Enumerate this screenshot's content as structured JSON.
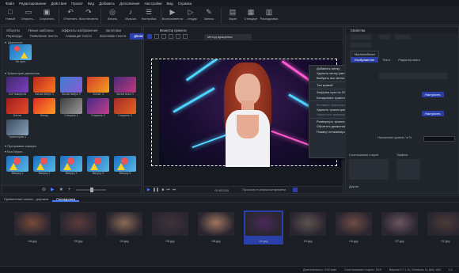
{
  "menu": [
    "Файл",
    "Редактирование",
    "Действия",
    "Проект",
    "Вид",
    "Добавить",
    "Дополнения",
    "Настройки",
    "Вид",
    "Справка"
  ],
  "toolbar": [
    {
      "label": "Новый",
      "icon": "□"
    },
    {
      "label": "Открыть…",
      "icon": "▭"
    },
    {
      "label": "Сохранить",
      "icon": "▣"
    },
    {
      "label": "Отменить",
      "icon": "↶"
    },
    {
      "label": "Восстановить",
      "icon": "↷"
    },
    {
      "label": "Изъять",
      "icon": "◎"
    },
    {
      "label": "Музыка",
      "icon": "♪"
    },
    {
      "label": "Настройка",
      "icon": "☰"
    },
    {
      "label": "Воспроизвести",
      "icon": "▶"
    },
    {
      "label": "…откуда",
      "icon": "▷"
    },
    {
      "label": "Запись",
      "icon": "✎"
    },
    {
      "label": "Экран",
      "icon": "▤"
    },
    {
      "label": "Стандарт",
      "icon": "▦"
    },
    {
      "label": "Раскадровка",
      "icon": "▥"
    }
  ],
  "left_panel": {
    "tabs_row1": [
      "Объекты",
      "Умные шаблоны",
      "Эффекты изображения",
      "Заголовки"
    ],
    "tabs_row2": [
      "Переходы",
      "Появление текста",
      "Анимация текста",
      "Заголовки текста",
      "Движение",
      "Фоны"
    ],
    "active_tab": "Движение",
    "section1": "Движение",
    "first_item": "Не путь",
    "section2": "Траектории движения",
    "items": [
      "2х2 поворота",
      "Зигзаг вверх 1",
      "Зигзаг вверх 2",
      "Зигзаг 3",
      "Зигзаг вниз 1",
      "Бегом",
      "Внизу",
      "Спираль 1",
      "Спираль 2",
      "Спираль 3",
      "Траектория 1"
    ],
    "section3": "Программы камеры",
    "section4": "Вся Верхн.",
    "camera_items": [
      "Вверху 1",
      "Вверху 2",
      "Вверху 3",
      "Вверху 4",
      "Вверху 5"
    ]
  },
  "center": {
    "title": "Монитор проекта",
    "dropdown": "Метод вращения",
    "timecode": "00:00.000",
    "preview_label": "Просмотр в реальном времени"
  },
  "context_menu": {
    "items": [
      {
        "label": "Добавить метку",
        "key": "Ins",
        "disabled": false
      },
      {
        "label": "Удалить метку (метки)",
        "key": "Del",
        "disabled": false
      },
      {
        "label": "Выбрать все метки",
        "key": "Ctrl+A",
        "disabled": false
      },
      {
        "label": "Тип кривой",
        "key": "›",
        "disabled": false
      },
      {
        "label": "Загрузка пути из SPX файла…",
        "key": "",
        "disabled": false
      },
      {
        "label": "Копировать траекторию",
        "key": "",
        "disabled": false
      },
      {
        "label": "Вставить траекторию",
        "key": "",
        "disabled": true
      },
      {
        "label": "Удалить траекторию",
        "key": "",
        "disabled": false
      },
      {
        "label": "Упростить траекторию",
        "key": "",
        "disabled": true
      },
      {
        "label": "Развернуть траекторию",
        "key": "",
        "disabled": false
      },
      {
        "label": "Обратить движение по пути",
        "key": "",
        "disabled": false
      },
      {
        "label": "Размер оптимизированное",
        "key": "",
        "disabled": false
      }
    ]
  },
  "right_panel": {
    "title": "Свойства",
    "tag": "Мультиобъект",
    "tabs": [
      "Изображение",
      "Текст",
      "Редактировать"
    ],
    "btn1": "Настроить",
    "btn2": "Настроить",
    "field": "Отключить (без настроек)",
    "label1": "Наложение уровня / в %",
    "label2": "Соотношение сторон",
    "label3": "Эффект",
    "footer": "Другие"
  },
  "bottom": {
    "tabs": [
      "Применение шкалы - дорожка",
      "Раскадровка"
    ],
    "active": "Раскадровка",
    "files": [
      "06.jpg",
      "09.jpg",
      "03.jpg",
      "05.jpg",
      "08.jpg",
      "02.jpg",
      "10.jpg",
      "04.jpg",
      "07.jpg",
      "01.jpg"
    ],
    "selected": "02.jpg"
  },
  "status": [
    "Длительность: 4:02 мин",
    "Соотношение сторон: 16:9",
    "Версия 17.1.11, Windows 11 (64); x64",
    "1:1"
  ]
}
